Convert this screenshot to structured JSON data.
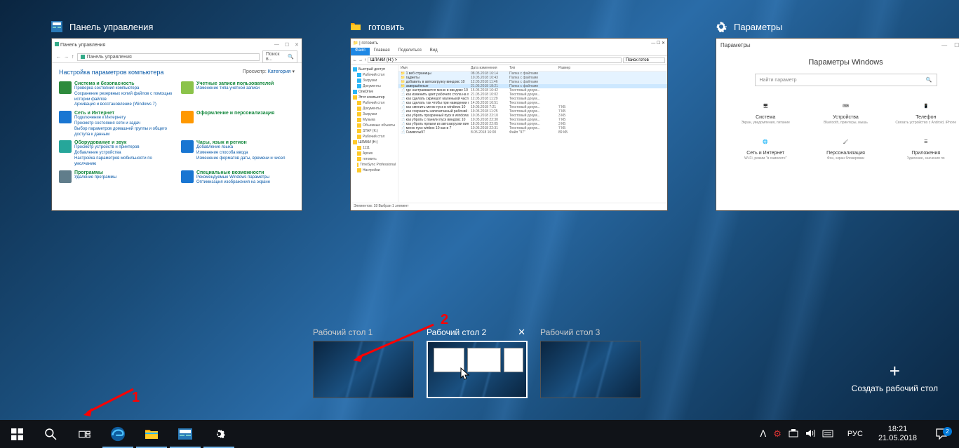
{
  "windows": {
    "control_panel": {
      "title": "Панель управления",
      "frame_title": "Панель управления",
      "breadcrumb": "Панель управления",
      "search_placeholder": "Поиск в...",
      "heading": "Настройка параметров компьютера",
      "view_label": "Просмотр:",
      "view_value": "Категория",
      "cats": [
        {
          "title": "Система и безопасность",
          "links": "Проверка состояния компьютера\nСохранение резервных копий файлов с помощью истории файлов\nАрхивация и восстановление (Windows 7)"
        },
        {
          "title": "Учетные записи пользователей",
          "links": "Изменение типа учетной записи"
        },
        {
          "title": "Сеть и Интернет",
          "links": "Подключение к Интернету\nПросмотр состояния сети и задач\nВыбор параметров домашней группы и общего доступа к данным"
        },
        {
          "title": "Оформление и персонализация",
          "links": ""
        },
        {
          "title": "Оборудование и звук",
          "links": "Просмотр устройств и принтеров\nДобавление устройства\nНастройка параметров мобильности по умолчанию"
        },
        {
          "title": "Часы, язык и регион",
          "links": "Добавление языка\nИзменение способа ввода\nИзменение форматов даты, времени и чисел"
        },
        {
          "title": "Программы",
          "links": "Удаление программы"
        },
        {
          "title": "Специальные возможности",
          "links": "Рекомендуемые Windows параметры\nОптимизация изображения на экране"
        }
      ]
    },
    "explorer": {
      "title": "готовить",
      "ribbon": [
        "Файл",
        "Главная",
        "Поделиться",
        "Вид"
      ],
      "address": "ШЛАКИ (Н:) >",
      "search_placeholder": "Поиск готов",
      "columns": [
        "Имя",
        "Дата изменения",
        "Тип",
        "Размер"
      ],
      "sidebar": [
        "Быстрый доступ",
        "Рабочий стол",
        "Загрузки",
        "Документы",
        "OneDrive",
        "Этот компьютер",
        "Рабочий стол",
        "Документы",
        "Загрузки",
        "Музыка",
        "Объемные объекты",
        "STAF (K:)",
        "Рабочий стол",
        "ШЛАКИ (Н:)",
        "1111",
        "Архив",
        "готовить",
        "TimeSync Professional",
        "Настройки"
      ],
      "rows": [
        {
          "n": "1 веб страницы",
          "d": "08.05.2018 16:14",
          "t": "Папка с файлами",
          "s": ""
        },
        {
          "n": "гаджеты",
          "d": "10.05.2018 10:43",
          "t": "Папка с файлами",
          "s": ""
        },
        {
          "n": "добавить в автозагрузку виндовс 10",
          "d": "12.05.2018 11:46",
          "t": "Папка с файлами",
          "s": ""
        },
        {
          "n": "завершённые",
          "d": "21.05.2018 18:21",
          "t": "Папка с файлами",
          "s": ""
        },
        {
          "n": "где настраивается меню в виндовс 10",
          "d": "15.05.2018 16:42",
          "t": "Текстовый докум...",
          "s": ""
        },
        {
          "n": "как изменить цвет рабочего стола на win...",
          "d": "21.05.2018 10:02",
          "t": "Текстовый докум...",
          "s": ""
        },
        {
          "n": "как сделать скриншот маленькой части э...",
          "d": "12.05.2018 11:29",
          "t": "Текстовый докум...",
          "s": ""
        },
        {
          "n": "как сделать так чтобы при наведении на п...",
          "d": "14.05.2018 16:51",
          "t": "Текстовый докум...",
          "s": ""
        },
        {
          "n": "как сменить меню пуск в windows 10",
          "d": "19.05.2018 7:21",
          "t": "Текстовый докум...",
          "s": "7 КБ"
        },
        {
          "n": "как сохранить напечатанный рабочий с...",
          "d": "19.05.2018 11:25",
          "t": "Текстовый докум...",
          "s": "7 КБ"
        },
        {
          "n": "как убрать прозрачный пуск в windows 10",
          "d": "10.05.2018 22:10",
          "t": "Текстовый докум...",
          "s": "3 КБ"
        },
        {
          "n": "как убрать с панели пуск виндовс 10",
          "d": "10.05.2018 22:30",
          "t": "Текстовый докум...",
          "s": "7 КБ"
        },
        {
          "n": "как убрать ярлыки из автозагрузки винд...",
          "d": "18.05.2018 22:05",
          "t": "Текстовый докум...",
          "s": "3 КБ"
        },
        {
          "n": "меню пуск winbox 10 как в 7",
          "d": "10.05.2018 22:31",
          "t": "Текстовый докум...",
          "s": "7 КБ"
        },
        {
          "n": "Символы97",
          "d": "8.05.2018 16:00",
          "t": "Файл \"97\"",
          "s": "89 КБ"
        }
      ],
      "status": "Элементов: 18    Выбран 1 элемент"
    },
    "settings": {
      "title": "Параметры",
      "frame_title": "Параметры",
      "heading": "Параметры Windows",
      "search_placeholder": "Найти параметр",
      "items": [
        {
          "title": "Система",
          "sub": "Экран, уведомления, питание"
        },
        {
          "title": "Устройства",
          "sub": "Bluetooth, принтеры, мышь"
        },
        {
          "title": "Телефон",
          "sub": "Связать устройство с Android, iPhone"
        },
        {
          "title": "Сеть и Интернет",
          "sub": "Wi-Fi, режим \"в самолете\""
        },
        {
          "title": "Персонализация",
          "sub": "Фон, экран блокировки"
        },
        {
          "title": "Приложения",
          "sub": "Удаление, значения по"
        }
      ]
    }
  },
  "desktops": [
    {
      "label": "Рабочий стол 1"
    },
    {
      "label": "Рабочий стол 2",
      "active": true
    },
    {
      "label": "Рабочий стол 3"
    }
  ],
  "new_desktop_label": "Создать рабочий стол",
  "taskbar": {
    "lang": "РУС",
    "time": "18:21",
    "date": "21.05.2018",
    "notif_count": "2"
  },
  "annotations": {
    "one": "1",
    "two": "2"
  }
}
